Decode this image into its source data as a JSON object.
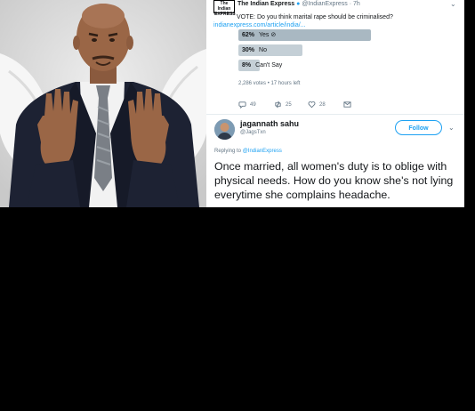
{
  "tweet1": {
    "logo_text": "The Indian EXPRESS",
    "author": "The Indian Express",
    "handle": "@IndianExpress · 7h",
    "question_prefix": "VOTE: Do you think marital rape should be criminalised?",
    "link": "indianexpress.com/article/india/...",
    "poll": [
      {
        "percent": "62%",
        "label": "Yes",
        "fraction": 0.62,
        "winner": true
      },
      {
        "percent": "30%",
        "label": "No",
        "fraction": 0.3,
        "winner": false
      },
      {
        "percent": "8%",
        "label": "Can't Say",
        "fraction": 0.08,
        "winner": false
      }
    ],
    "poll_meta": "2,286 votes • 17 hours left",
    "replies": "49",
    "retweets": "25",
    "likes": "28"
  },
  "tweet2": {
    "name": "jagannath sahu",
    "handle": "@JagsTxn",
    "follow_label": "Follow",
    "replying_prefix": "Replying to",
    "replying_handle": "@IndianExpress",
    "text": "Once married, all women's duty is to oblige with physical needs. How do you know she's not lying everytime she complains headache."
  },
  "colors": {
    "accent": "#1da1f2",
    "poll_bar": "#c4cfd6",
    "background": "#000000"
  }
}
